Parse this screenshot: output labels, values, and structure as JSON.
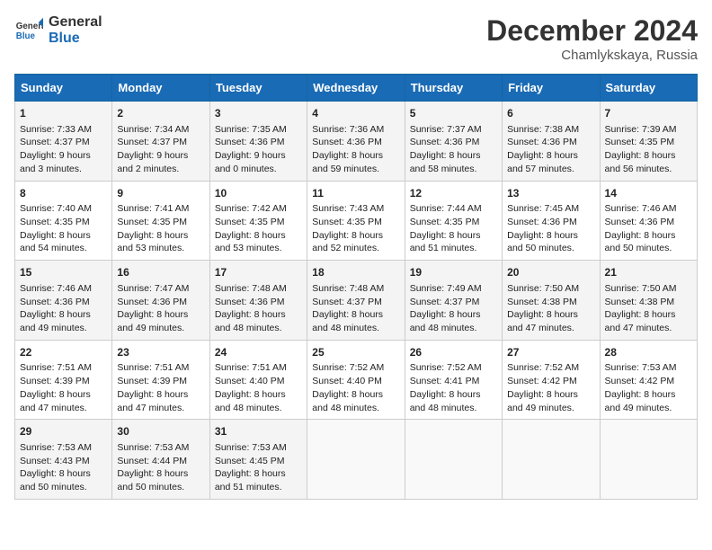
{
  "header": {
    "logo_line1": "General",
    "logo_line2": "Blue",
    "month": "December 2024",
    "location": "Chamlykskaya, Russia"
  },
  "weekdays": [
    "Sunday",
    "Monday",
    "Tuesday",
    "Wednesday",
    "Thursday",
    "Friday",
    "Saturday"
  ],
  "weeks": [
    [
      {
        "day": "1",
        "sunrise": "Sunrise: 7:33 AM",
        "sunset": "Sunset: 4:37 PM",
        "daylight": "Daylight: 9 hours and 3 minutes."
      },
      {
        "day": "2",
        "sunrise": "Sunrise: 7:34 AM",
        "sunset": "Sunset: 4:37 PM",
        "daylight": "Daylight: 9 hours and 2 minutes."
      },
      {
        "day": "3",
        "sunrise": "Sunrise: 7:35 AM",
        "sunset": "Sunset: 4:36 PM",
        "daylight": "Daylight: 9 hours and 0 minutes."
      },
      {
        "day": "4",
        "sunrise": "Sunrise: 7:36 AM",
        "sunset": "Sunset: 4:36 PM",
        "daylight": "Daylight: 8 hours and 59 minutes."
      },
      {
        "day": "5",
        "sunrise": "Sunrise: 7:37 AM",
        "sunset": "Sunset: 4:36 PM",
        "daylight": "Daylight: 8 hours and 58 minutes."
      },
      {
        "day": "6",
        "sunrise": "Sunrise: 7:38 AM",
        "sunset": "Sunset: 4:36 PM",
        "daylight": "Daylight: 8 hours and 57 minutes."
      },
      {
        "day": "7",
        "sunrise": "Sunrise: 7:39 AM",
        "sunset": "Sunset: 4:35 PM",
        "daylight": "Daylight: 8 hours and 56 minutes."
      }
    ],
    [
      {
        "day": "8",
        "sunrise": "Sunrise: 7:40 AM",
        "sunset": "Sunset: 4:35 PM",
        "daylight": "Daylight: 8 hours and 54 minutes."
      },
      {
        "day": "9",
        "sunrise": "Sunrise: 7:41 AM",
        "sunset": "Sunset: 4:35 PM",
        "daylight": "Daylight: 8 hours and 53 minutes."
      },
      {
        "day": "10",
        "sunrise": "Sunrise: 7:42 AM",
        "sunset": "Sunset: 4:35 PM",
        "daylight": "Daylight: 8 hours and 53 minutes."
      },
      {
        "day": "11",
        "sunrise": "Sunrise: 7:43 AM",
        "sunset": "Sunset: 4:35 PM",
        "daylight": "Daylight: 8 hours and 52 minutes."
      },
      {
        "day": "12",
        "sunrise": "Sunrise: 7:44 AM",
        "sunset": "Sunset: 4:35 PM",
        "daylight": "Daylight: 8 hours and 51 minutes."
      },
      {
        "day": "13",
        "sunrise": "Sunrise: 7:45 AM",
        "sunset": "Sunset: 4:36 PM",
        "daylight": "Daylight: 8 hours and 50 minutes."
      },
      {
        "day": "14",
        "sunrise": "Sunrise: 7:46 AM",
        "sunset": "Sunset: 4:36 PM",
        "daylight": "Daylight: 8 hours and 50 minutes."
      }
    ],
    [
      {
        "day": "15",
        "sunrise": "Sunrise: 7:46 AM",
        "sunset": "Sunset: 4:36 PM",
        "daylight": "Daylight: 8 hours and 49 minutes."
      },
      {
        "day": "16",
        "sunrise": "Sunrise: 7:47 AM",
        "sunset": "Sunset: 4:36 PM",
        "daylight": "Daylight: 8 hours and 49 minutes."
      },
      {
        "day": "17",
        "sunrise": "Sunrise: 7:48 AM",
        "sunset": "Sunset: 4:36 PM",
        "daylight": "Daylight: 8 hours and 48 minutes."
      },
      {
        "day": "18",
        "sunrise": "Sunrise: 7:48 AM",
        "sunset": "Sunset: 4:37 PM",
        "daylight": "Daylight: 8 hours and 48 minutes."
      },
      {
        "day": "19",
        "sunrise": "Sunrise: 7:49 AM",
        "sunset": "Sunset: 4:37 PM",
        "daylight": "Daylight: 8 hours and 48 minutes."
      },
      {
        "day": "20",
        "sunrise": "Sunrise: 7:50 AM",
        "sunset": "Sunset: 4:38 PM",
        "daylight": "Daylight: 8 hours and 47 minutes."
      },
      {
        "day": "21",
        "sunrise": "Sunrise: 7:50 AM",
        "sunset": "Sunset: 4:38 PM",
        "daylight": "Daylight: 8 hours and 47 minutes."
      }
    ],
    [
      {
        "day": "22",
        "sunrise": "Sunrise: 7:51 AM",
        "sunset": "Sunset: 4:39 PM",
        "daylight": "Daylight: 8 hours and 47 minutes."
      },
      {
        "day": "23",
        "sunrise": "Sunrise: 7:51 AM",
        "sunset": "Sunset: 4:39 PM",
        "daylight": "Daylight: 8 hours and 47 minutes."
      },
      {
        "day": "24",
        "sunrise": "Sunrise: 7:51 AM",
        "sunset": "Sunset: 4:40 PM",
        "daylight": "Daylight: 8 hours and 48 minutes."
      },
      {
        "day": "25",
        "sunrise": "Sunrise: 7:52 AM",
        "sunset": "Sunset: 4:40 PM",
        "daylight": "Daylight: 8 hours and 48 minutes."
      },
      {
        "day": "26",
        "sunrise": "Sunrise: 7:52 AM",
        "sunset": "Sunset: 4:41 PM",
        "daylight": "Daylight: 8 hours and 48 minutes."
      },
      {
        "day": "27",
        "sunrise": "Sunrise: 7:52 AM",
        "sunset": "Sunset: 4:42 PM",
        "daylight": "Daylight: 8 hours and 49 minutes."
      },
      {
        "day": "28",
        "sunrise": "Sunrise: 7:53 AM",
        "sunset": "Sunset: 4:42 PM",
        "daylight": "Daylight: 8 hours and 49 minutes."
      }
    ],
    [
      {
        "day": "29",
        "sunrise": "Sunrise: 7:53 AM",
        "sunset": "Sunset: 4:43 PM",
        "daylight": "Daylight: 8 hours and 50 minutes."
      },
      {
        "day": "30",
        "sunrise": "Sunrise: 7:53 AM",
        "sunset": "Sunset: 4:44 PM",
        "daylight": "Daylight: 8 hours and 50 minutes."
      },
      {
        "day": "31",
        "sunrise": "Sunrise: 7:53 AM",
        "sunset": "Sunset: 4:45 PM",
        "daylight": "Daylight: 8 hours and 51 minutes."
      },
      null,
      null,
      null,
      null
    ]
  ]
}
